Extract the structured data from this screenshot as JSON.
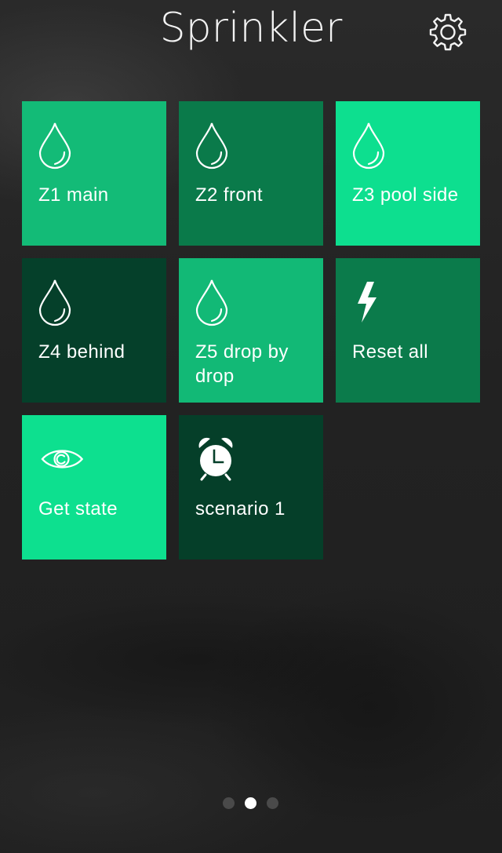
{
  "header": {
    "title": "Sprinkler",
    "settings_icon": "gear-icon"
  },
  "tiles": [
    {
      "label": "Z1 main",
      "icon": "water-drop-icon",
      "color": "#13bb77"
    },
    {
      "label": "Z2 front",
      "icon": "water-drop-icon",
      "color": "#0a7a4a"
    },
    {
      "label": "Z3 pool side",
      "icon": "water-drop-icon",
      "color": "#0ddf8f"
    },
    {
      "label": "Z4 behind",
      "icon": "water-drop-icon",
      "color": "#05402a"
    },
    {
      "label": "Z5 drop by drop",
      "icon": "water-drop-icon",
      "color": "#12b976"
    },
    {
      "label": "Reset all",
      "icon": "lightning-bolt-icon",
      "color": "#0b7b4b"
    },
    {
      "label": "Get state",
      "icon": "eye-icon",
      "color": "#0de08f"
    },
    {
      "label": "scenario 1",
      "icon": "alarm-clock-icon",
      "color": "#053f29"
    }
  ],
  "pagination": {
    "page_count": 3,
    "current_page": 2
  },
  "colors": {
    "background": "#232323",
    "dot_active": "#ffffff",
    "dot_inactive": "#4a4a4a"
  }
}
